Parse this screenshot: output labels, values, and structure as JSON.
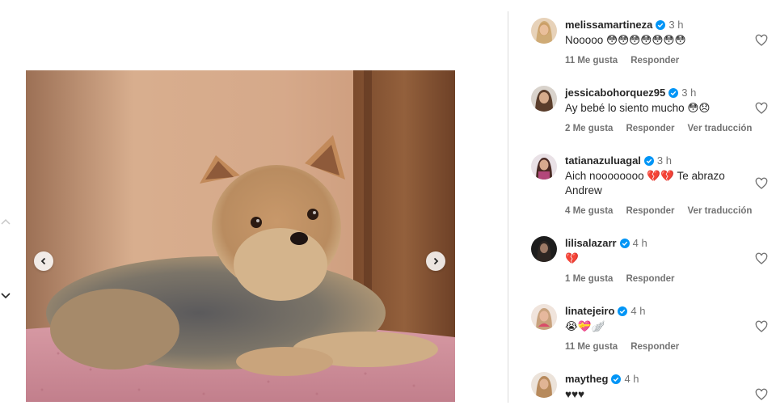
{
  "post": {
    "image_alt": "Yorkshire terrier lying on a pink blanket",
    "prev_icon": "chevron-left-icon",
    "next_icon": "chevron-right-icon"
  },
  "side_nav": {
    "up_icon": "chevron-up-icon",
    "down_icon": "chevron-down-icon"
  },
  "comments": [
    {
      "user": "melissamartineza",
      "verified": true,
      "time": "3 h",
      "text": "Nooooo 😳😳😳😳😳😳😳",
      "likes": "11 Me gusta",
      "reply": "Responder",
      "translate": ""
    },
    {
      "user": "jessicabohorquez95",
      "verified": true,
      "time": "3 h",
      "text": "Ay bebé lo siento mucho 😳😞",
      "likes": "2 Me gusta",
      "reply": "Responder",
      "translate": "Ver traducción"
    },
    {
      "user": "tatianazuluagal",
      "verified": true,
      "time": "3 h",
      "text": "Aich noooooooo 💔💔 Te abrazo Andrew",
      "likes": "4 Me gusta",
      "reply": "Responder",
      "translate": "Ver traducción"
    },
    {
      "user": "lilisalazarr",
      "verified": true,
      "time": "4 h",
      "text": "💔",
      "likes": "1 Me gusta",
      "reply": "Responder",
      "translate": ""
    },
    {
      "user": "linatejeiro",
      "verified": true,
      "time": "4 h",
      "text": "😭💝🪽",
      "likes": "11 Me gusta",
      "reply": "Responder",
      "translate": ""
    },
    {
      "user": "maytheg",
      "verified": true,
      "time": "4 h",
      "text": "♥♥♥",
      "likes": "",
      "reply": "",
      "translate": ""
    }
  ],
  "colors": {
    "verified": "#0095f6",
    "muted": "#737373",
    "text": "#262626"
  }
}
